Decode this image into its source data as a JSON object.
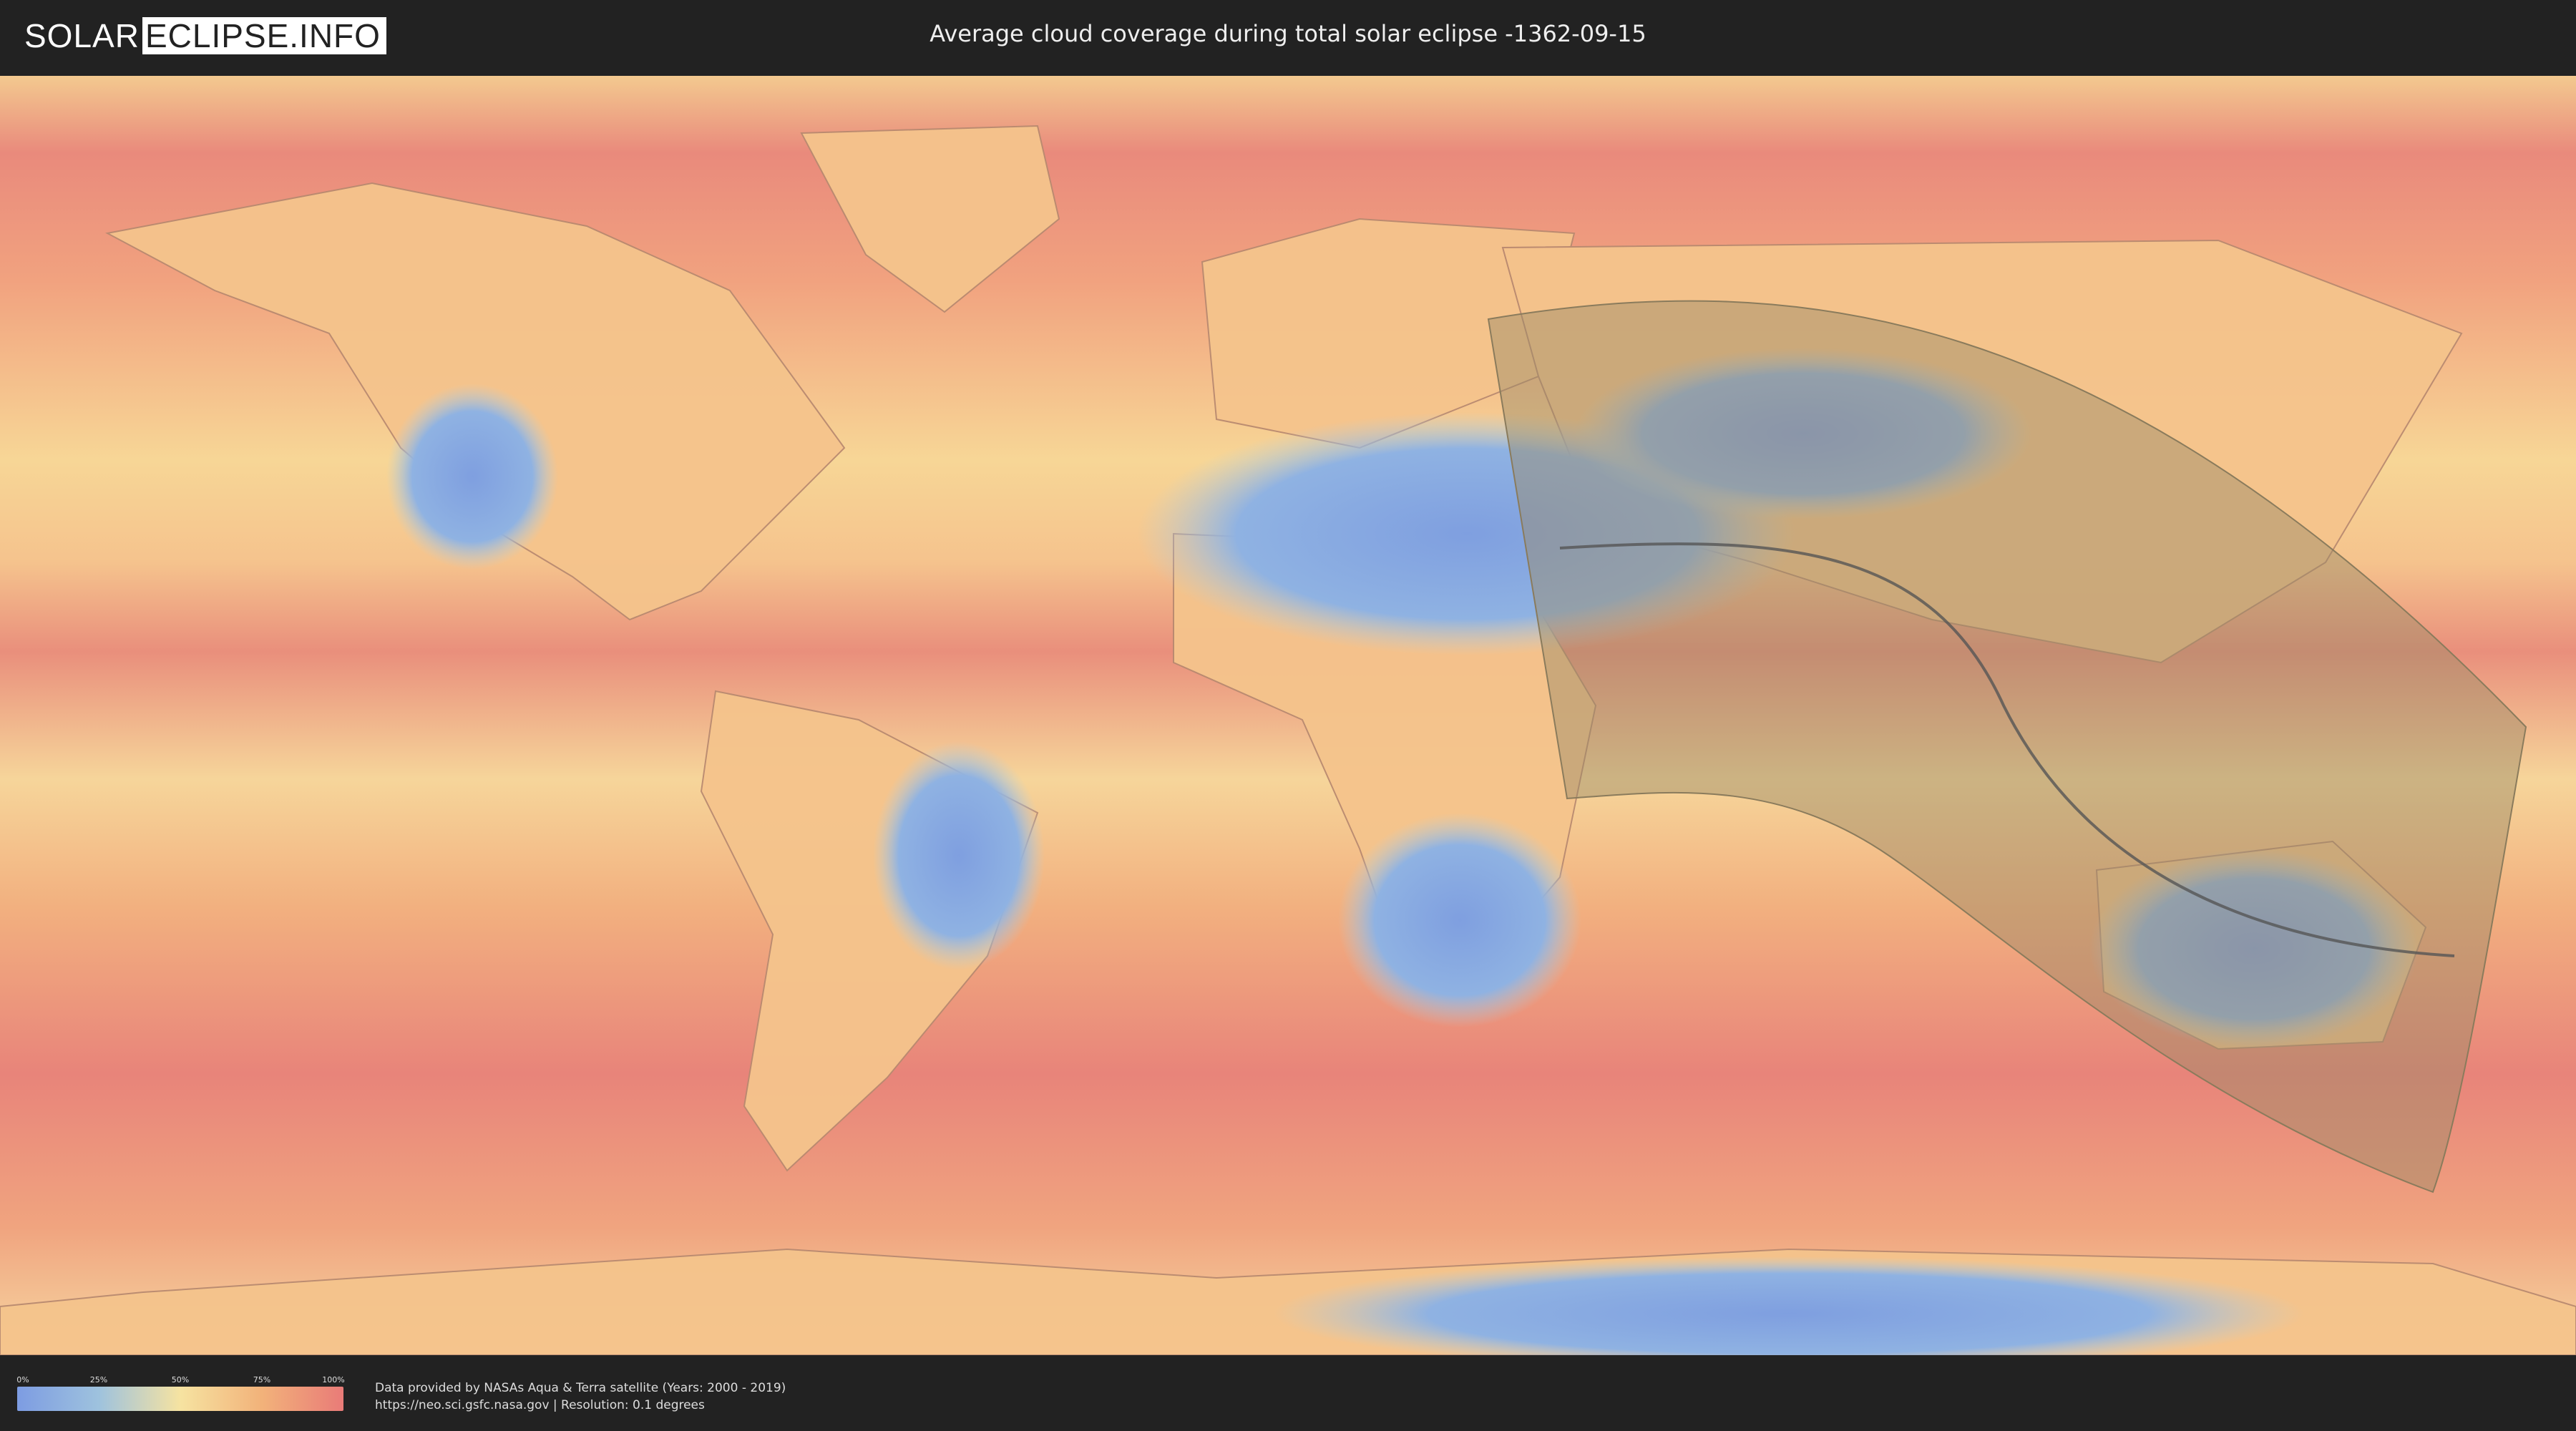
{
  "header": {
    "logo_left": "SOLAR",
    "logo_right": "ECLIPSE.INFO",
    "title": "Average cloud coverage during total solar eclipse -1362-09-15"
  },
  "legend": {
    "ticks": [
      "0%",
      "25%",
      "50%",
      "75%",
      "100%"
    ],
    "gradient_colors": [
      "#7d9ce2",
      "#9ec2de",
      "#f6e3a1",
      "#f2b27a",
      "#e97b78"
    ]
  },
  "credits": {
    "line1": "Data provided by NASAs Aqua & Terra satellite (Years: 2000 - 2019)",
    "line2": "https://neo.sci.gsfc.nasa.gov | Resolution: 0.1 degrees"
  },
  "map": {
    "projection": "equirectangular",
    "overlay_color": "#9a8a66",
    "central_line_color": "#555555"
  }
}
